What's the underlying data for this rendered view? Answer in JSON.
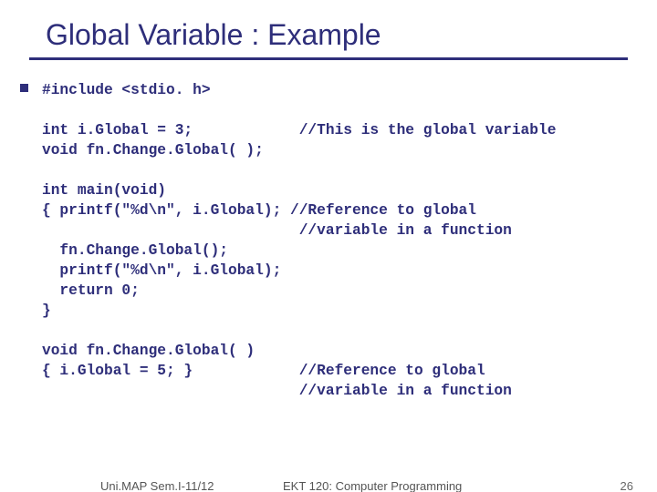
{
  "title": "Global Variable : Example",
  "code": "#include <stdio. h>\n\nint i.Global = 3;            //This is the global variable\nvoid fn.Change.Global( );\n\nint main(void)\n{ printf(\"%d\\n\", i.Global); //Reference to global\n                             //variable in a function\n  fn.Change.Global();\n  printf(\"%d\\n\", i.Global);\n  return 0;\n}\n\nvoid fn.Change.Global( )\n{ i.Global = 5; }            //Reference to global\n                             //variable in a function",
  "footer": {
    "left": "Uni.MAP Sem.I-11/12",
    "center": "EKT 120: Computer Programming",
    "right": "26"
  }
}
